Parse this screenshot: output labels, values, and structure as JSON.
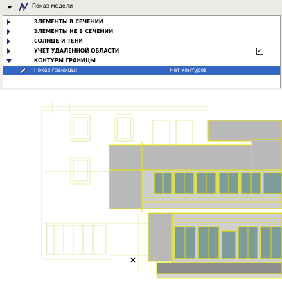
{
  "header": {
    "title": "Показ модели",
    "arrow_icon": "chevron-down-icon",
    "icon": "model-view-icon"
  },
  "tree": {
    "items": [
      {
        "label": "ЭЛЕМЕНТЫ В СЕЧЕНИИ",
        "expanded": false
      },
      {
        "label": "ЭЛЕМЕНТЫ НЕ В СЕЧЕНИИ",
        "expanded": false
      },
      {
        "label": "СОЛНЦЕ И ТЕНИ",
        "expanded": false
      },
      {
        "label": "УЧЕТ УДАЛЕННОЙ ОБЛАСТИ",
        "expanded": false,
        "checked": true,
        "check_mark": "✓"
      },
      {
        "label": "КОНТУРЫ ГРАНИЦЫ",
        "expanded": true
      }
    ],
    "selected_row": {
      "label": "Показ границы:",
      "value": "Нет контуров",
      "icon": "pencil-icon"
    }
  },
  "colors": {
    "selection": "#3467c4",
    "outline": "#e6e600",
    "wall": "#b9b9b9",
    "glass": "#7f9b98"
  }
}
